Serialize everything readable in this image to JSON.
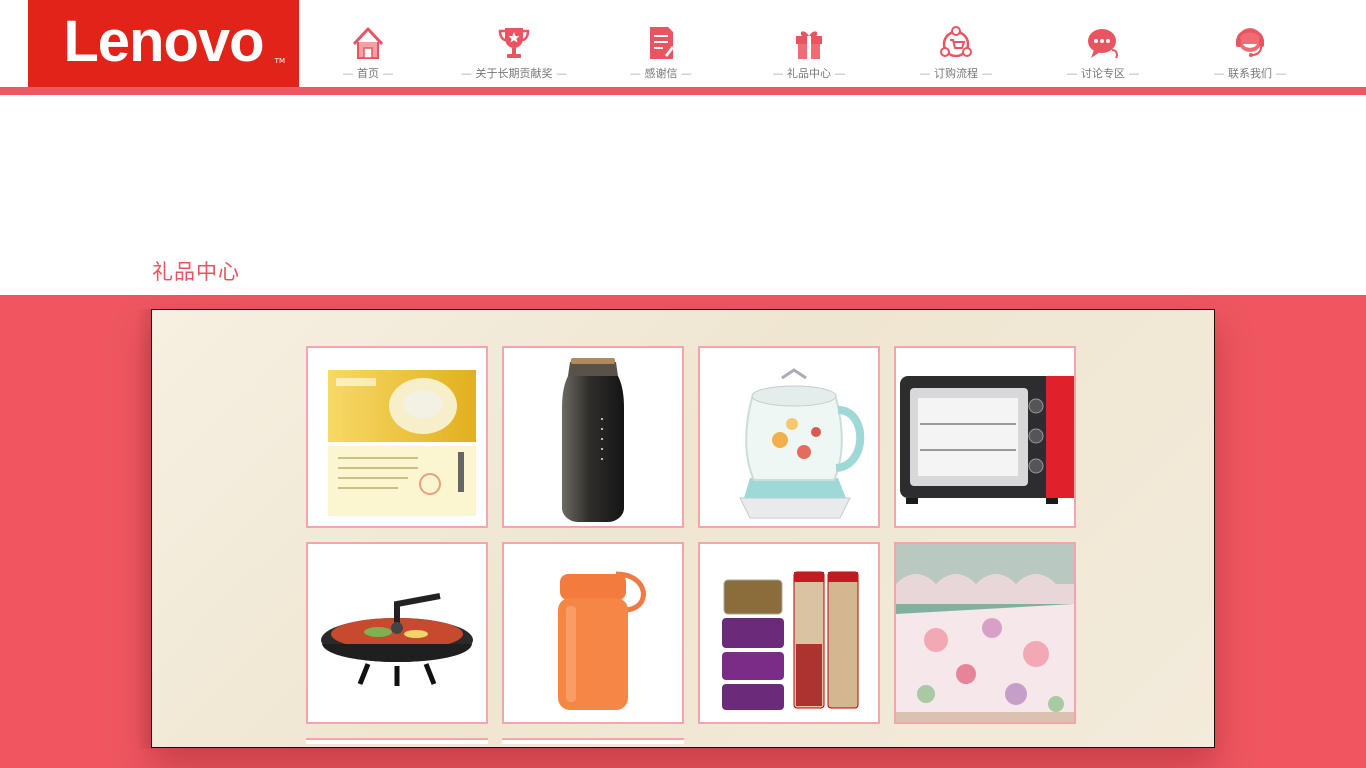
{
  "brand": {
    "name": "Lenovo",
    "trademark": "TM"
  },
  "nav": [
    {
      "label": "首页",
      "icon": "home-icon"
    },
    {
      "label": "关于长期贡献奖",
      "icon": "trophy-icon"
    },
    {
      "label": "感谢信",
      "icon": "letter-icon"
    },
    {
      "label": "礼品中心",
      "icon": "gift-icon"
    },
    {
      "label": "订购流程",
      "icon": "order-flow-icon"
    },
    {
      "label": "讨论专区",
      "icon": "chat-icon"
    },
    {
      "label": "联系我们",
      "icon": "support-headset-icon"
    }
  ],
  "section": {
    "title": "礼品中心"
  },
  "products": [
    {
      "name": "gift-voucher-card"
    },
    {
      "name": "black-thermos-bottle"
    },
    {
      "name": "glass-health-kettle"
    },
    {
      "name": "electric-oven"
    },
    {
      "name": "electric-hot-pot"
    },
    {
      "name": "orange-food-jar"
    },
    {
      "name": "food-storage-containers"
    },
    {
      "name": "floral-bedding-set"
    }
  ],
  "colors": {
    "accent": "#ef5660",
    "logo": "#e2231a",
    "card_border": "#f3a5ab",
    "paper": "#f3ebdb"
  }
}
